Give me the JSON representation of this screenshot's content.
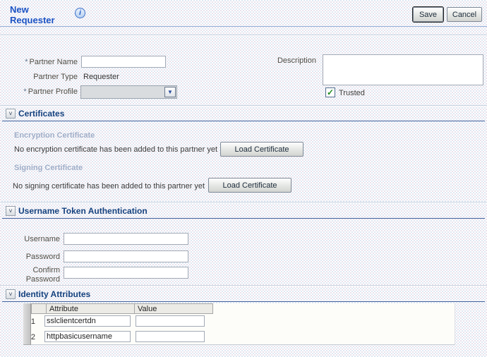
{
  "header": {
    "title": "New Requester",
    "info_icon_glyph": "i",
    "save_label": "Save",
    "cancel_label": "Cancel"
  },
  "form": {
    "partner_name": {
      "label": "Partner Name",
      "required_marker": "*",
      "value": ""
    },
    "partner_type": {
      "label": "Partner Type",
      "value": "Requester"
    },
    "partner_profile": {
      "label": "Partner Profile",
      "required_marker": "*",
      "selected_value": "",
      "arrow_glyph": "▼"
    },
    "description": {
      "label": "Description",
      "value": ""
    },
    "trusted": {
      "label": "Trusted",
      "checked": true,
      "check_glyph": "✓"
    }
  },
  "sections": {
    "certificates": {
      "title": "Certificates",
      "collapse_glyph": "˅",
      "encryption": {
        "subtitle": "Encryption Certificate",
        "empty_message": "No encryption certificate has been added to this partner yet",
        "button_label": "Load Certificate"
      },
      "signing": {
        "subtitle": "Signing Certificate",
        "empty_message": "No signing certificate has been added to this partner yet",
        "button_label": "Load Certificate"
      }
    },
    "username_token": {
      "title": "Username Token Authentication",
      "collapse_glyph": "˅",
      "username": {
        "label": "Username",
        "value": ""
      },
      "password": {
        "label": "Password",
        "value": ""
      },
      "confirm_password": {
        "label": "Confirm Password",
        "value": ""
      }
    },
    "identity_attributes": {
      "title": "Identity Attributes",
      "collapse_glyph": "˅",
      "table": {
        "columns": {
          "attribute": "Attribute",
          "value": "Value"
        },
        "rows": [
          {
            "num": "1",
            "attribute": "sslclientcertdn",
            "value": ""
          },
          {
            "num": "2",
            "attribute": "httpbasicusername",
            "value": ""
          }
        ]
      }
    }
  },
  "colors": {
    "title_blue": "#1b52c4",
    "section_title": "#15427f",
    "section_underline": "#41629e",
    "subsection_gray_blue": "#a0aec8",
    "check_green": "#1d8a1d",
    "background_tint": "#dfe8f3"
  }
}
